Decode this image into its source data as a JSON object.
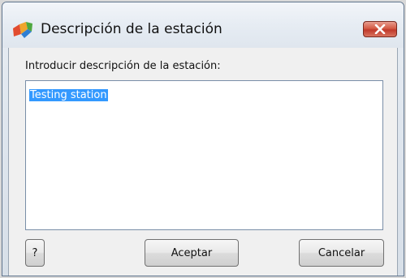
{
  "window": {
    "title": "Descripción de la estación",
    "icon": "avg-logo-icon"
  },
  "dialog": {
    "prompt_label": "Introducir descripción de la estación:",
    "description_value": "Testing station"
  },
  "buttons": {
    "help_label": "?",
    "accept_label": "Aceptar",
    "cancel_label": "Cancelar"
  },
  "colors": {
    "selection": "#3399ff",
    "close_button": "#c0392b"
  }
}
